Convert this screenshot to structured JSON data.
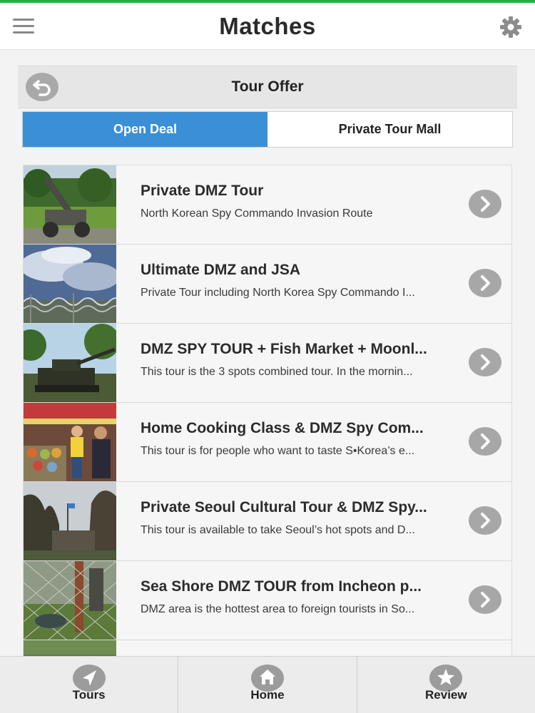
{
  "app": {
    "title": "Matches"
  },
  "panel": {
    "title": "Tour Offer"
  },
  "tabs": [
    {
      "label": "Open Deal",
      "active": true
    },
    {
      "label": "Private Tour Mall",
      "active": false
    }
  ],
  "tours": [
    {
      "title": "Private DMZ Tour",
      "description": "North Korean Spy Commando Invasion Route",
      "thumbnail": "howitzer-on-lawn"
    },
    {
      "title": "Ultimate DMZ and JSA",
      "description": "Private Tour including North Korea Spy Commando I...",
      "thumbnail": "barbed-wire-sky"
    },
    {
      "title": "DMZ SPY TOUR + Fish Market + Moonl...",
      "description": "This tour is the 3 spots combined tour. In the mornin...",
      "thumbnail": "tank-under-trees"
    },
    {
      "title": "Home Cooking Class & DMZ Spy Com...",
      "description": "This tour is for people who want to taste S•Korea’s e...",
      "thumbnail": "market-stall"
    },
    {
      "title": "Private Seoul Cultural Tour & DMZ Spy...",
      "description": "This tour is available to take Seoul’s hot spots and D...",
      "thumbnail": "trees-overcast"
    },
    {
      "title": "Sea Shore DMZ TOUR from Incheon p...",
      "description": "DMZ area is the hottest area to foreign tourists in So...",
      "thumbnail": "fence-and-crab"
    }
  ],
  "bottom_nav": [
    {
      "label": "Tours",
      "icon": "navigation-arrow-icon"
    },
    {
      "label": "Home",
      "icon": "home-icon"
    },
    {
      "label": "Review",
      "icon": "star-icon"
    }
  ],
  "colors": {
    "status_line": "#1fb24a",
    "tab_active": "#3a8fd6",
    "icon_gray": "#a7a7a7"
  }
}
